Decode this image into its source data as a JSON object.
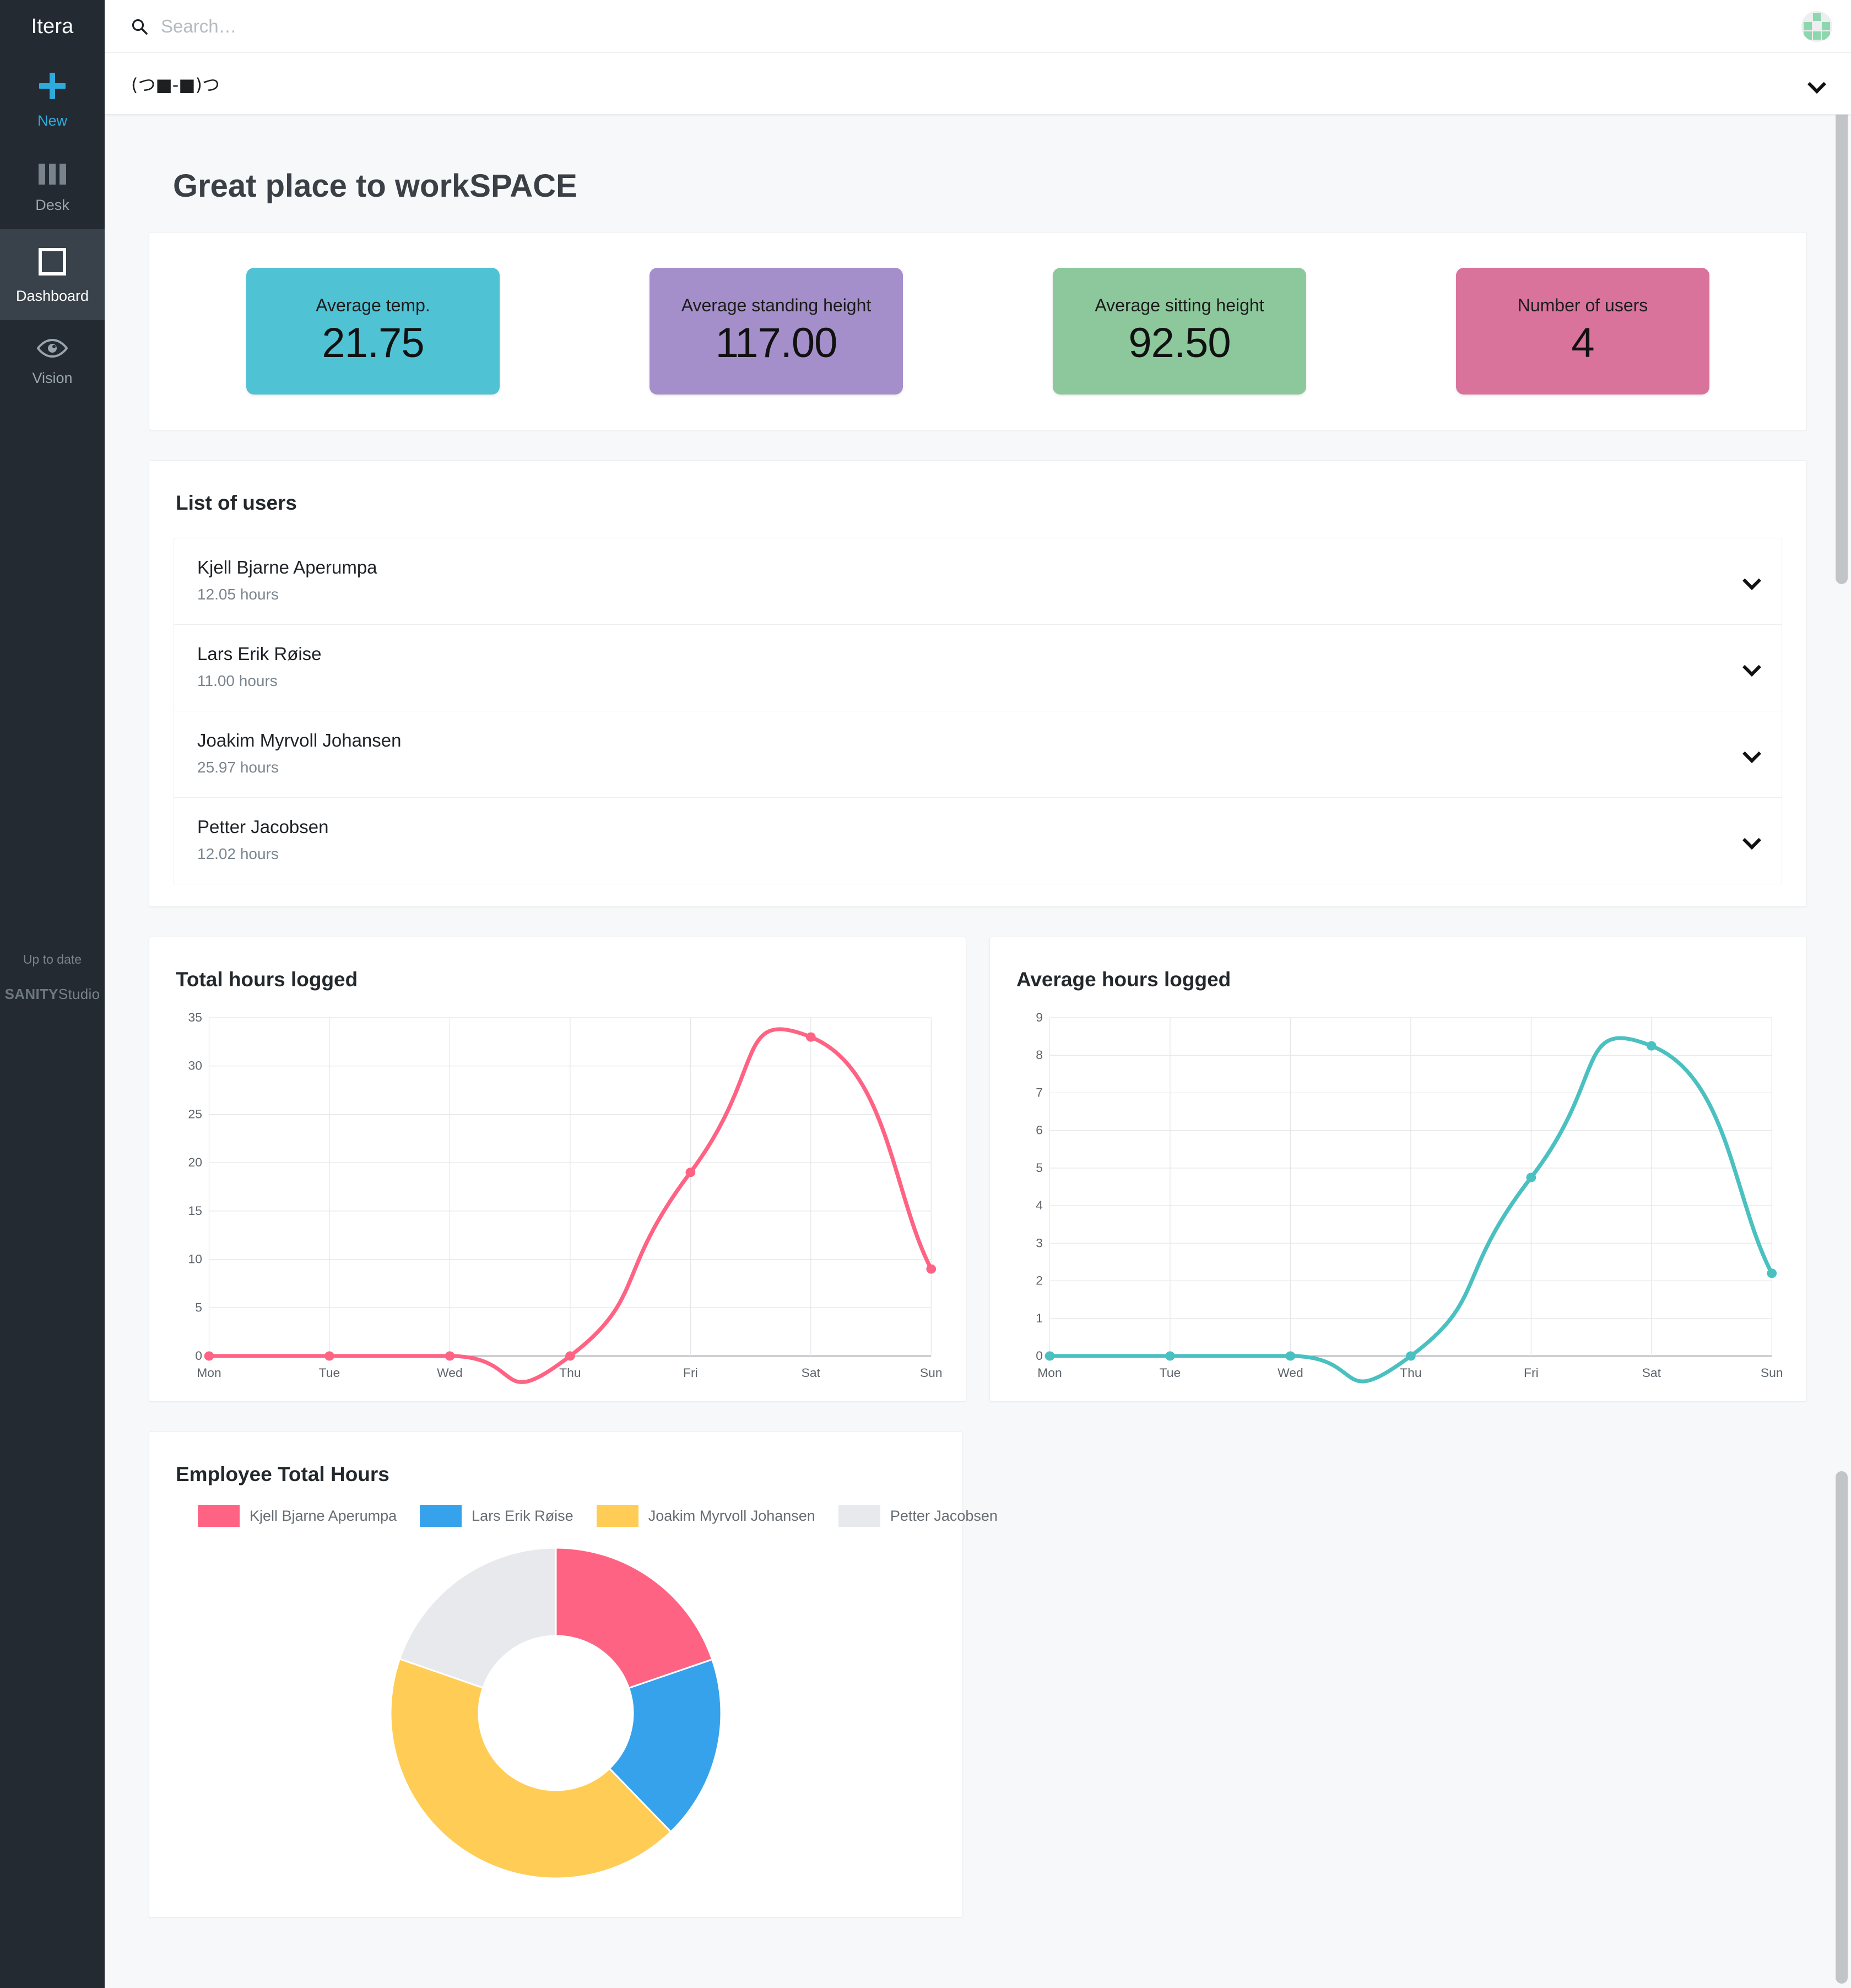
{
  "sidebar": {
    "brand": "Itera",
    "items": [
      {
        "label": "New",
        "icon": "plus-icon"
      },
      {
        "label": "Desk",
        "icon": "columns-icon"
      },
      {
        "label": "Dashboard",
        "icon": "square-icon"
      },
      {
        "label": "Vision",
        "icon": "eye-icon"
      }
    ],
    "status": "Up to date",
    "studio_brand_bold": "SANITY",
    "studio_brand_light": "Studio"
  },
  "topbar": {
    "search_placeholder": "Search…",
    "search_value": "",
    "search_icon": "search-icon",
    "avatar": "avatar"
  },
  "docbar": {
    "title": "(つ■-■)つ",
    "chevron": "chevron-down-icon"
  },
  "page": {
    "title": "Great place to workSPACE"
  },
  "metrics": [
    {
      "label": "Average temp.",
      "value": "21.75",
      "color": "#4fc2d4"
    },
    {
      "label": "Average standing height",
      "value": "117.00",
      "color": "#a48fcb"
    },
    {
      "label": "Average sitting height",
      "value": "92.50",
      "color": "#8cc89b"
    },
    {
      "label": "Number of users",
      "value": "4",
      "color": "#d9739c"
    }
  ],
  "users_section": {
    "title": "List of users",
    "rows": [
      {
        "name": "Kjell Bjarne Aperumpa",
        "hours": "12.05 hours",
        "chevron": "chevron-down-icon"
      },
      {
        "name": "Lars Erik Røise",
        "hours": "11.00 hours",
        "chevron": "chevron-down-icon"
      },
      {
        "name": "Joakim Myrvoll Johansen",
        "hours": "25.97 hours",
        "chevron": "chevron-down-icon"
      },
      {
        "name": "Petter Jacobsen",
        "hours": "12.02 hours",
        "chevron": "chevron-down-icon"
      }
    ]
  },
  "chart_data": [
    {
      "type": "line",
      "title": "Total hours logged",
      "categories": [
        "Mon",
        "Tue",
        "Wed",
        "Thu",
        "Fri",
        "Sat",
        "Sun"
      ],
      "values": [
        0,
        0,
        0,
        0,
        19,
        33,
        9
      ],
      "yticks": [
        0,
        5,
        10,
        15,
        20,
        25,
        30,
        35
      ],
      "ylim": [
        0,
        35
      ],
      "xlabel": "",
      "ylabel": "",
      "grid": true,
      "legend": "none",
      "color": "#ff6384"
    },
    {
      "type": "line",
      "title": "Average hours logged",
      "categories": [
        "Mon",
        "Tue",
        "Wed",
        "Thu",
        "Fri",
        "Sat",
        "Sun"
      ],
      "values": [
        0,
        0,
        0,
        0,
        4.75,
        8.25,
        2.2
      ],
      "yticks": [
        0,
        1,
        2,
        3,
        4,
        5,
        6,
        7,
        8,
        9
      ],
      "ylim": [
        0,
        9
      ],
      "xlabel": "",
      "ylabel": "",
      "grid": true,
      "legend": "none",
      "color": "#4bc0c0"
    },
    {
      "type": "pie",
      "title": "Employee Total Hours",
      "labels": [
        "Kjell Bjarne Aperumpa",
        "Lars Erik Røise",
        "Joakim Myrvoll Johansen",
        "Petter Jacobsen"
      ],
      "values": [
        12.05,
        11.0,
        25.97,
        12.02
      ],
      "colors": [
        "#ff6384",
        "#36a2eb",
        "#ffcd56",
        "#e7e9ed"
      ],
      "legend": "top",
      "donut": true
    }
  ]
}
